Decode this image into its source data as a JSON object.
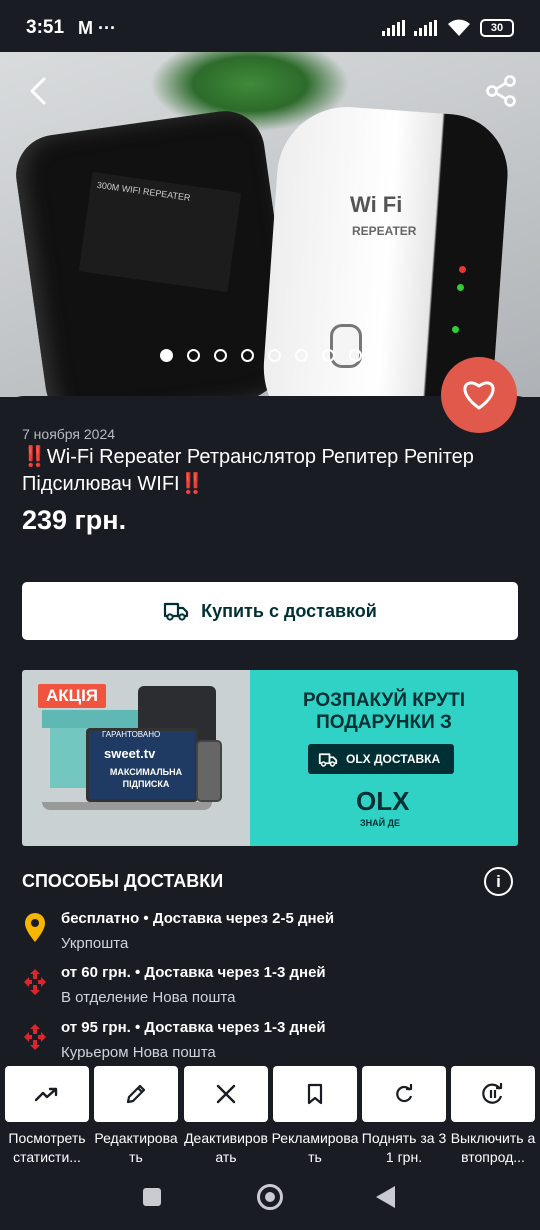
{
  "status_bar": {
    "time": "3:51",
    "left_icons": "M ···",
    "battery": "30",
    "icons": [
      "signal-icon",
      "signal-icon",
      "wifi-icon",
      "battery-icon"
    ]
  },
  "gallery": {
    "slide_count": 8,
    "active_index": 0,
    "photo_text": {
      "repeater_logo": "Wi Fi",
      "repeater_sub": "REPEATER",
      "charger_label": "300M WIFI REPEATER"
    }
  },
  "listing": {
    "date": "7 ноября 2024",
    "title": "‼️Wi-Fi Repeater Ретранслятор Репитер Репітер Підсилювач WIFI‼️",
    "price": "239 грн."
  },
  "buy_button": {
    "label": "Купить с доставкой"
  },
  "banner": {
    "badge": "АКЦІЯ",
    "laptop_small": "ГАРАНТОВАНО",
    "laptop_brand": "sweet.tv",
    "laptop_text": "МАКСИМАЛЬНА ПІДПИСКА",
    "headline": "РОЗПАКУЙ КРУТІ ПОДАРУНКИ З",
    "delivery_label": "OLX ДОСТАВКА",
    "logo": "OLX",
    "slogan": "ЗНАЙ ДЕ"
  },
  "delivery": {
    "section_title": "СПОСОБЫ ДОСТАВКИ",
    "info_icon": "i",
    "items": [
      {
        "icon": "ukrposhta-icon",
        "line1": "бесплатно • Доставка через 2-5 дней",
        "line2": "Укрпошта"
      },
      {
        "icon": "nova-poshta-icon",
        "line1": "от 60 грн. • Доставка через 1-3 дней",
        "line2": "В отделение Нова пошта"
      },
      {
        "icon": "nova-poshta-icon",
        "line1": "от 95 грн. • Доставка через 1-3 дней",
        "line2": "Курьером Нова пошта"
      }
    ]
  },
  "actions": [
    {
      "icon": "trending-up-icon",
      "label": "Посмотреть статисти..."
    },
    {
      "icon": "pencil-icon",
      "label": "Редактировать"
    },
    {
      "icon": "close-icon",
      "label": "Деактивировать"
    },
    {
      "icon": "bookmark-icon",
      "label": "Рекламировать"
    },
    {
      "icon": "refresh-icon",
      "label": "Поднять за 31 грн."
    },
    {
      "icon": "pause-icon",
      "label": "Выключить автопрод..."
    }
  ],
  "colors": {
    "background": "#1a1c24",
    "favorite": "#e0594b",
    "olx_dark": "#002f34",
    "olx_teal": "#2fd2c4",
    "promo_red": "#f0533e"
  }
}
